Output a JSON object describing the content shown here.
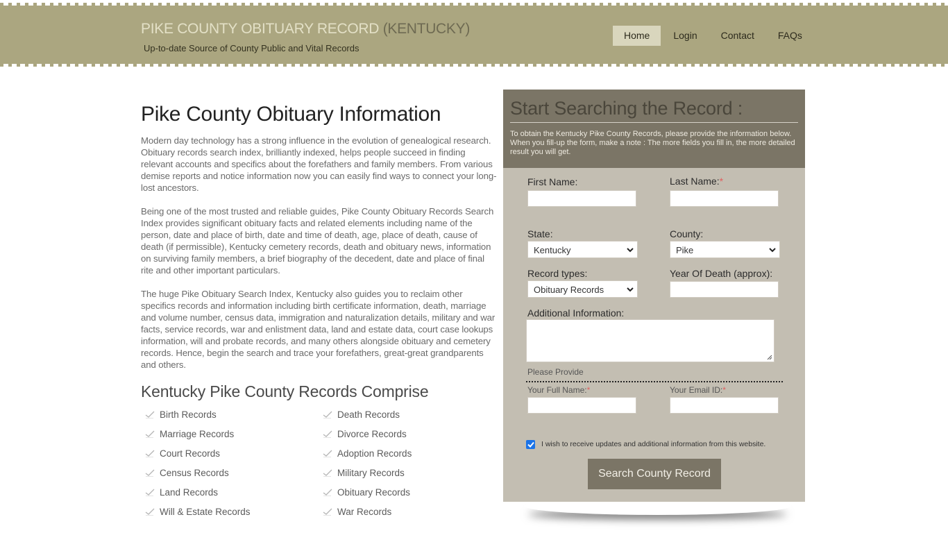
{
  "header": {
    "site_title": "PIKE COUNTY OBITUARY RECORD",
    "site_title_state": "(KENTUCKY)",
    "tagline": "Up-to-date Source of  County Public and Vital Records",
    "nav": [
      {
        "label": "Home",
        "active": true
      },
      {
        "label": "Login",
        "active": false
      },
      {
        "label": "Contact",
        "active": false
      },
      {
        "label": "FAQs",
        "active": false
      }
    ]
  },
  "main": {
    "title": "Pike County Obituary Information",
    "paragraphs": [
      "Modern day technology has a strong influence in the evolution of genealogical research. Obituary records search index, brilliantly indexed, helps people succeed in finding relevant accounts and specifics about the forefathers and family members. From various demise reports and notice information now you can easily find ways to connect your long-lost ancestors.",
      "Being one of the most trusted and reliable guides, Pike County Obituary Records Search Index provides significant obituary facts and related elements including name of the person, date and place of birth, date and time of death, age, place of death, cause of death (if permissible), Kentucky cemetery records, death and obituary news, information on surviving family members, a brief biography of the decedent, date and place of final rite and other important particulars.",
      "The huge Pike Obituary Search Index, Kentucky also guides you to reclaim other specifics records and information including birth certificate information, death, marriage and volume number, census data, immigration and naturalization details, military and war facts, service records, war and enlistment data, land and estate data, court case lookups information, will and probate records, and many others alongside obituary and cemetery records. Hence, begin the search and trace your forefathers, great-great grandparents and others."
    ],
    "records_title": "Kentucky Pike County Records Comprise",
    "records": [
      "Birth Records",
      "Death Records",
      "Marriage Records",
      "Divorce Records",
      "Court Records",
      "Adoption Records",
      "Census Records",
      "Military Records",
      "Land Records",
      "Obituary Records",
      "Will & Estate Records",
      "War Records"
    ]
  },
  "form": {
    "title": "Start Searching the Record :",
    "description": "To obtain the Kentucky Pike County Records, please provide the information below. When you fill-up the form, make a note : The more fields you fill in, the more detailed result you will get.",
    "first_name_label": "First Name:",
    "first_name_value": "",
    "last_name_label": "Last Name:",
    "last_name_value": "",
    "required_mark": "*",
    "state_label": "State:",
    "state_value": "Kentucky",
    "county_label": "County:",
    "county_value": "Pike",
    "record_types_label": "Record types:",
    "record_types_value": "Obituary Records",
    "year_label": "Year Of Death (approx):",
    "year_value": "",
    "additional_label": "Additional Information:",
    "additional_value": "",
    "please_provide": "Please Provide",
    "full_name_label": "Your Full Name:",
    "full_name_value": "",
    "email_label": "Your Email ID:",
    "email_value": "",
    "consent_checked": true,
    "consent_label": "I wish to receive updates and additional information from this website.",
    "submit_label": "Search County Record"
  },
  "colors": {
    "header_bg": "#aba680",
    "panel_head_bg": "#7b7566",
    "panel_bg": "#c3beb2",
    "active_nav_bg": "#d9d6bd",
    "required": "#e06060",
    "checkbox": "#1a73e8"
  }
}
